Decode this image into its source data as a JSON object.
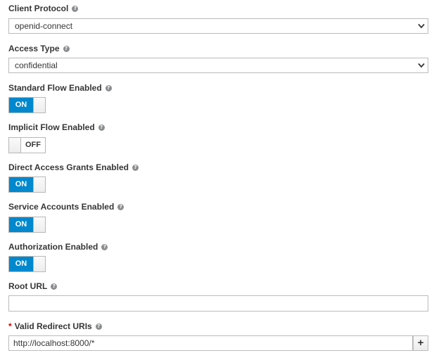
{
  "fields": {
    "client_protocol": {
      "label": "Client Protocol",
      "value": "openid-connect"
    },
    "access_type": {
      "label": "Access Type",
      "value": "confidential"
    },
    "standard_flow": {
      "label": "Standard Flow Enabled",
      "state": "ON"
    },
    "implicit_flow": {
      "label": "Implicit Flow Enabled",
      "state": "OFF"
    },
    "direct_access": {
      "label": "Direct Access Grants Enabled",
      "state": "ON"
    },
    "service_accounts": {
      "label": "Service Accounts Enabled",
      "state": "ON"
    },
    "authorization": {
      "label": "Authorization Enabled",
      "state": "ON"
    },
    "root_url": {
      "label": "Root URL",
      "value": ""
    },
    "redirect_uris": {
      "label": "Valid Redirect URIs",
      "required_marker": "*",
      "value": "http://localhost:8000/*",
      "add_label": "+"
    }
  },
  "help_icon": {
    "icon": "question-circle-icon",
    "glyph": "?"
  },
  "colors": {
    "toggle_on": "#0088ce",
    "required": "#cc0000",
    "help": "#8b8d8f"
  }
}
